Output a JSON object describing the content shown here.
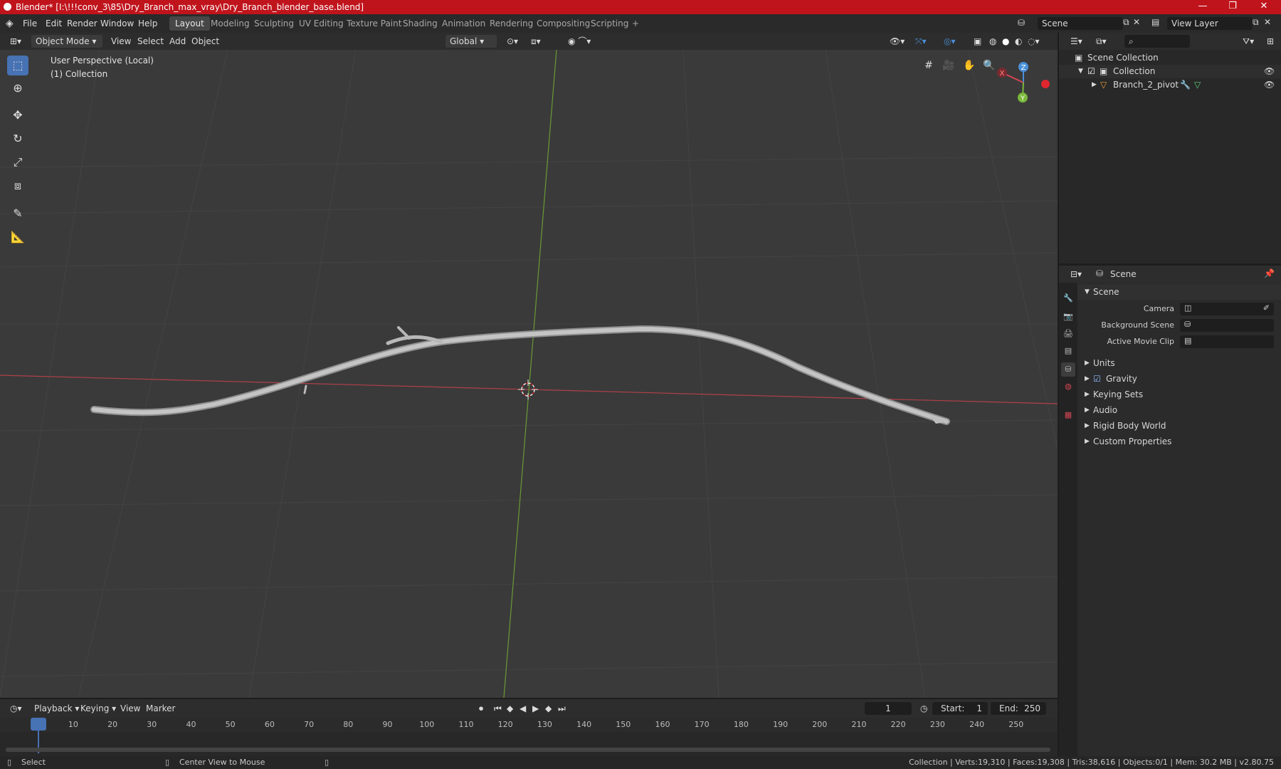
{
  "window": {
    "title": "Blender* [I:\\!!!conv_3\\85\\Dry_Branch_max_vray\\Dry_Branch_blender_base.blend]",
    "minimize": "—",
    "maximize": "❐",
    "close": "✕"
  },
  "menu": {
    "file": "File",
    "edit": "Edit",
    "render": "Render",
    "window": "Window",
    "help": "Help"
  },
  "workspaces": [
    "Layout",
    "Modeling",
    "Sculpting",
    "UV Editing",
    "Texture Paint",
    "Shading",
    "Animation",
    "Rendering",
    "Compositing",
    "Scripting"
  ],
  "add_workspace": "+",
  "scene_field": "Scene",
  "view_layer_field": "View Layer",
  "viewport": {
    "mode": "Object Mode",
    "menus": {
      "view": "View",
      "select": "Select",
      "add": "Add",
      "object": "Object"
    },
    "orientation": "Global",
    "overlay_line1": "User Perspective (Local)",
    "overlay_line2": "(1) Collection",
    "gizmo": {
      "x": "X",
      "y": "Y",
      "z": "Z"
    }
  },
  "outliner": {
    "scene_collection": "Scene Collection",
    "collection": "Collection",
    "object": "Branch_2_pivot"
  },
  "properties": {
    "header": "Scene",
    "panel_title": "Scene",
    "camera_label": "Camera",
    "background_scene_label": "Background Scene",
    "active_movie_clip_label": "Active Movie Clip",
    "panels": [
      "Units",
      "Gravity",
      "Keying Sets",
      "Audio",
      "Rigid Body World",
      "Custom Properties"
    ]
  },
  "timeline": {
    "menus": {
      "playback": "Playback",
      "keying": "Keying",
      "view": "View",
      "marker": "Marker"
    },
    "current_frame": "1",
    "start_label": "Start:",
    "start_value": "1",
    "end_label": "End:",
    "end_value": "250",
    "ticks": [
      "1",
      "10",
      "20",
      "30",
      "40",
      "50",
      "60",
      "70",
      "80",
      "90",
      "100",
      "110",
      "120",
      "130",
      "140",
      "150",
      "160",
      "170",
      "180",
      "190",
      "200",
      "210",
      "220",
      "230",
      "240",
      "250"
    ]
  },
  "status": {
    "select": "Select",
    "center": "Center View to Mouse",
    "stats": "Collection | Verts:19,310 | Faces:19,308 | Tris:38,616 | Objects:0/1 | Mem: 30.2 MB | v2.80.75"
  },
  "colors": {
    "title_bar": "#c0141c",
    "accent": "#4772b3",
    "x_axis": "#d44653",
    "y_axis": "#7ab83a",
    "z_axis": "#4a8fd8"
  }
}
